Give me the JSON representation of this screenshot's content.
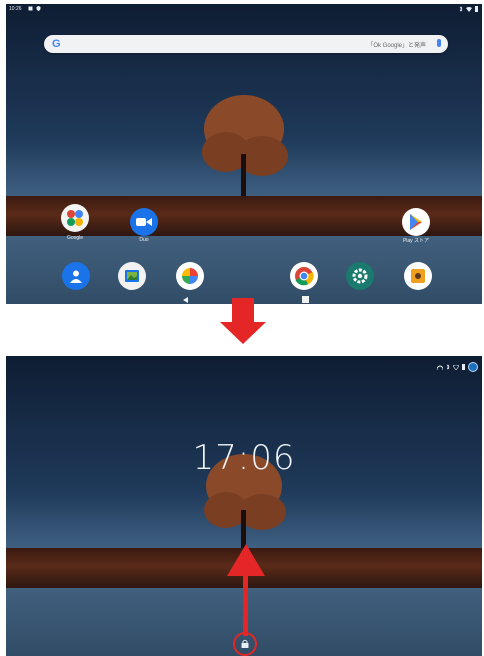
{
  "home": {
    "status_time": "10:26",
    "search_hint": "「Ok Google」と発声",
    "search_logo": "G",
    "apps_row1": [
      {
        "label": "Google",
        "icon": "google-folder-icon"
      },
      {
        "label": "Duo",
        "icon": "duo-video-icon"
      },
      {
        "label": "Play ストア",
        "icon": "play-store-icon"
      }
    ],
    "dock": [
      "contacts-icon",
      "gallery-icon",
      "photos-pinwheel-icon",
      "chrome-icon",
      "settings-icon",
      "music-icon"
    ],
    "nav": [
      "back-icon",
      "home-icon",
      "recents-icon"
    ]
  },
  "lock": {
    "time": "17:06"
  },
  "colors": {
    "arrow": "#e52626",
    "search_bg": "#f1f2f4"
  }
}
